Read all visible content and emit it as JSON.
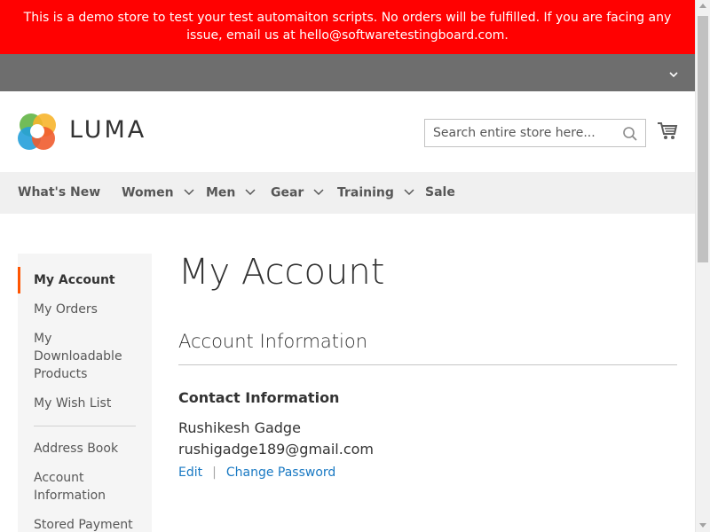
{
  "banner": {
    "text": "This is a demo store to test your test automaiton scripts. No orders will be fulfilled. If you are facing any issue, email us at hello@softwaretestingboard.com."
  },
  "header": {
    "logo_text": "LUMA",
    "search_placeholder": "Search entire store here..."
  },
  "nav": {
    "items": [
      {
        "label": "What's New"
      },
      {
        "label": "Women"
      },
      {
        "label": "Men"
      },
      {
        "label": "Gear"
      },
      {
        "label": "Training"
      },
      {
        "label": "Sale"
      }
    ]
  },
  "sidebar": {
    "items": [
      {
        "label": "My Account"
      },
      {
        "label": "My Orders"
      },
      {
        "label": "My Downloadable Products"
      },
      {
        "label": "My Wish List"
      },
      {
        "label": "Address Book"
      },
      {
        "label": "Account Information"
      },
      {
        "label": "Stored Payment"
      }
    ]
  },
  "main": {
    "title": "My Account",
    "block_title": "Account Information",
    "contact": {
      "title": "Contact Information",
      "name": "Rushikesh Gadge",
      "email": "rushigadge189@gmail.com",
      "edit_label": "Edit",
      "separator": "|",
      "change_password_label": "Change Password"
    }
  },
  "colors": {
    "banner_bg": "#ff0101",
    "top_bar_bg": "#6e6e6e",
    "nav_bg": "#f0f0f0",
    "sidebar_bg": "#f5f5f5",
    "active_marker": "#ff5501",
    "link": "#1979c3"
  },
  "icons": [
    "chevron-down-icon",
    "luma-logo-icon",
    "search-icon",
    "cart-icon",
    "caret-down-icon"
  ]
}
